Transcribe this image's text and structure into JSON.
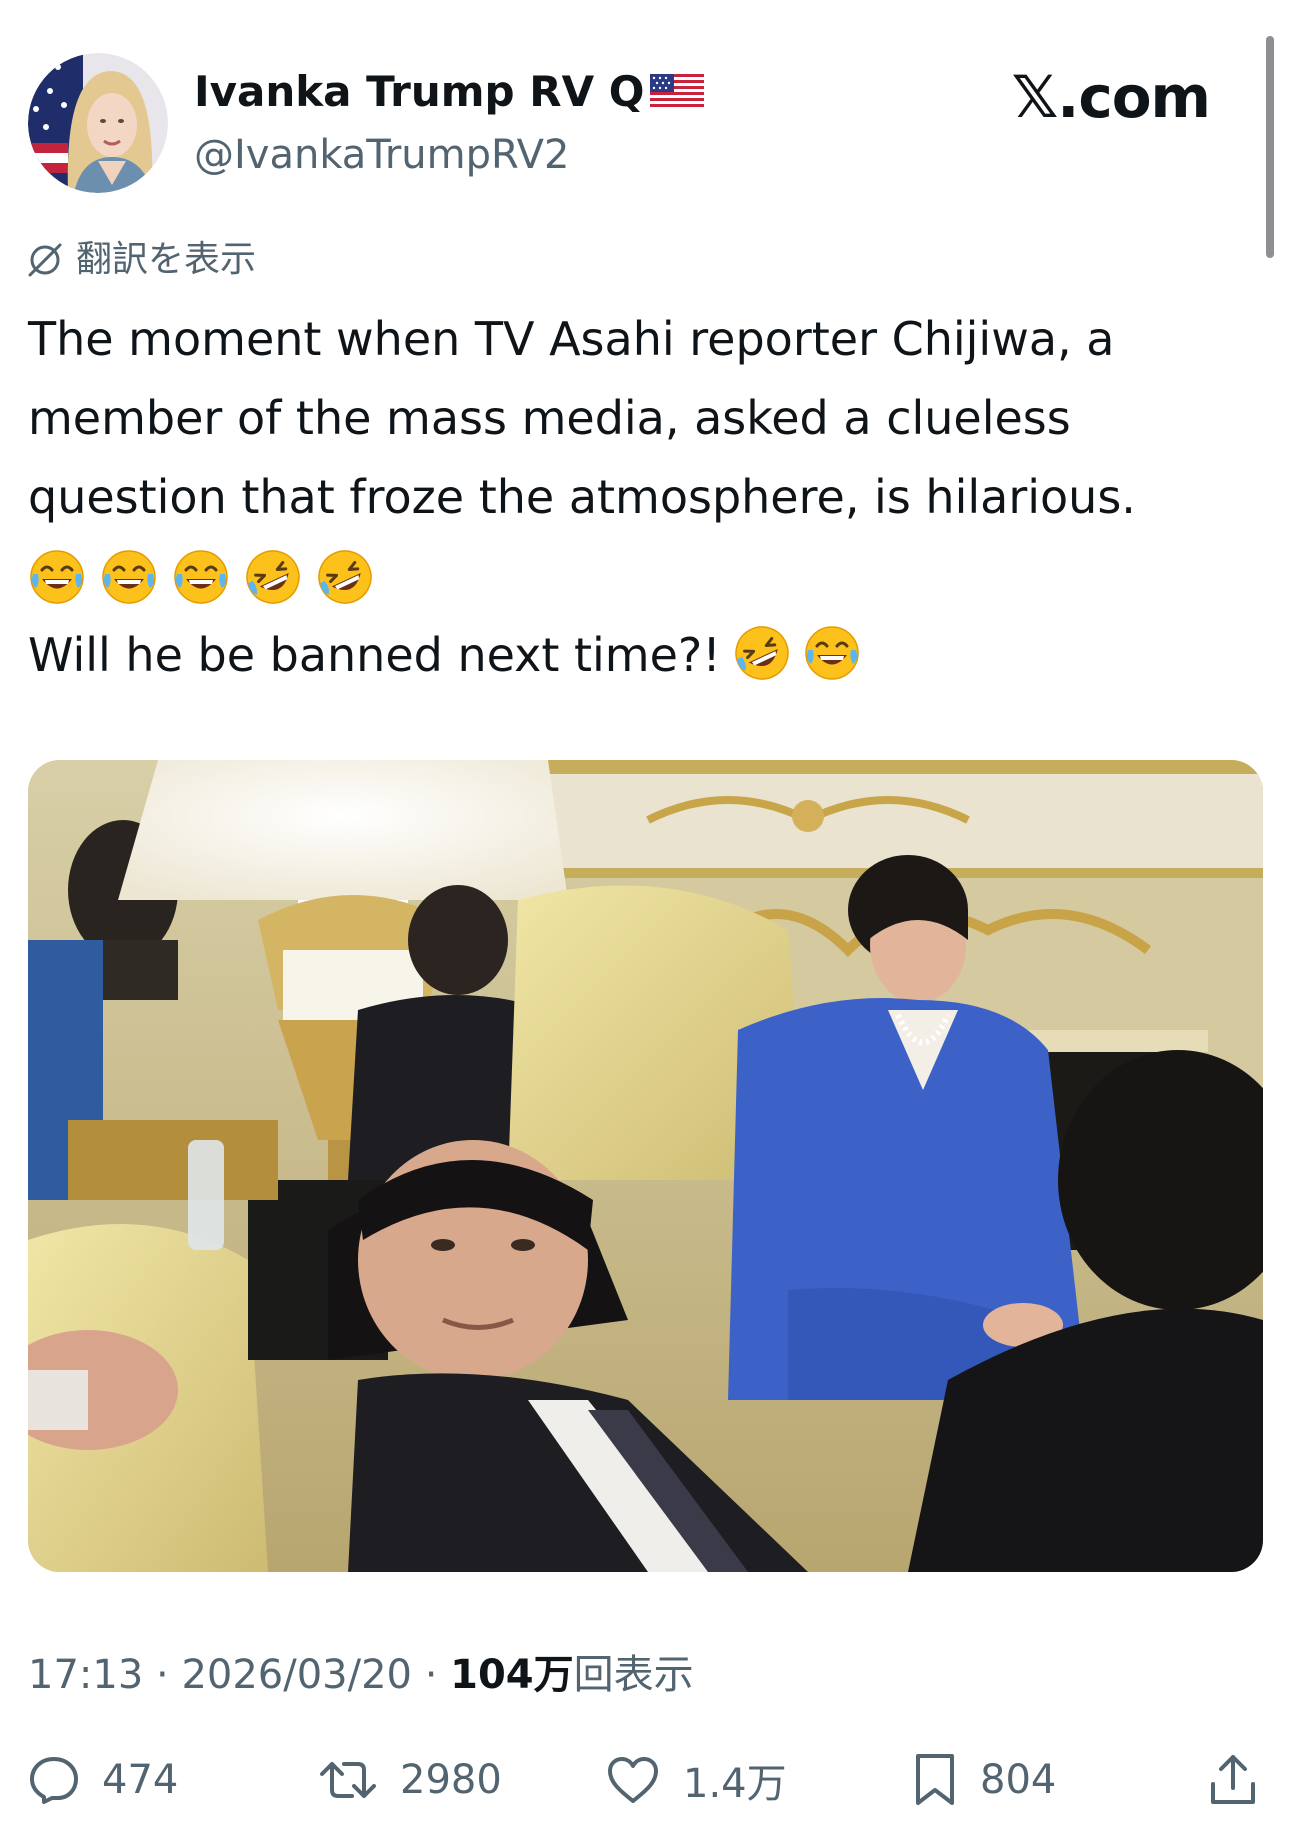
{
  "header": {
    "display_name": "Ivanka Trump RV Q",
    "handle": "@IvankaTrumpRV2",
    "brand": "𝕏.com",
    "avatar_icon": "profile-photo",
    "flag_icon": "us-flag-icon"
  },
  "translate": {
    "label": "翻訳を表示",
    "icon": "globe-icon"
  },
  "tweet": {
    "lines": [
      "The moment when TV Asahi reporter Chijiwa, a",
      "member of the mass media, asked a clueless",
      "question that froze the atmosphere, is hilarious."
    ],
    "emoji_row": [
      "😂",
      "😂",
      "😂",
      "🤣",
      "🤣"
    ],
    "last_line": "Will he be banned next time?!",
    "last_line_emojis": [
      "🤣",
      "😂"
    ]
  },
  "media": {
    "type": "photo"
  },
  "meta": {
    "time": "17:13",
    "separator": "·",
    "date": "2026/03/20",
    "views_count": "104万",
    "views_label": "回表示"
  },
  "actions": {
    "replies": "474",
    "reposts": "2980",
    "likes": "1.4万",
    "bookmarks": "804"
  },
  "colors": {
    "text": "#0f1419",
    "secondary": "#536471",
    "background": "#ffffff"
  }
}
